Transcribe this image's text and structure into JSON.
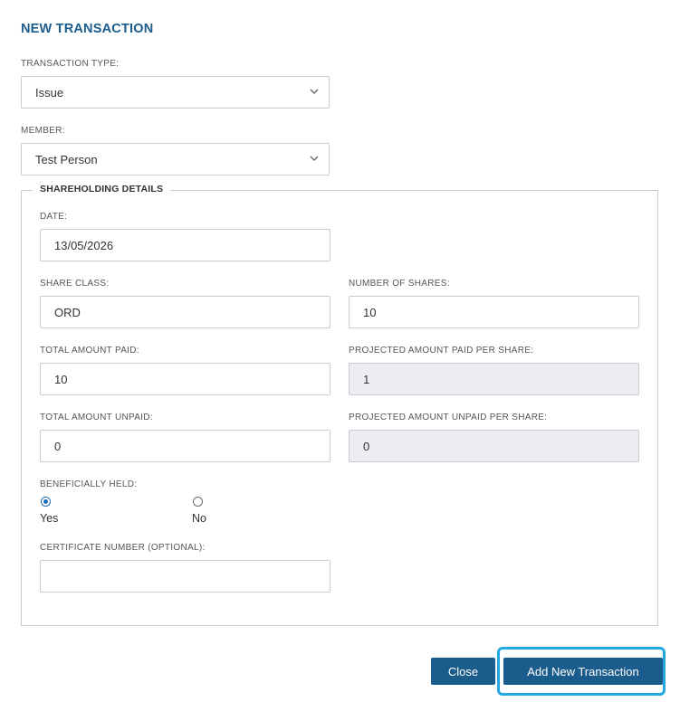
{
  "form": {
    "title": "NEW TRANSACTION",
    "transaction_type": {
      "label": "TRANSACTION TYPE:",
      "value": "Issue"
    },
    "member": {
      "label": "MEMBER:",
      "value": "Test Person"
    }
  },
  "shareholding": {
    "legend": "SHAREHOLDING DETAILS",
    "date": {
      "label": "DATE:",
      "value": "13/05/2026"
    },
    "share_class": {
      "label": "SHARE CLASS:",
      "value": "ORD"
    },
    "number_of_shares": {
      "label": "NUMBER OF SHARES:",
      "value": "10"
    },
    "total_amount_paid": {
      "label": "TOTAL AMOUNT PAID:",
      "value": "10"
    },
    "projected_paid_per_share": {
      "label": "PROJECTED AMOUNT PAID PER SHARE:",
      "value": "1"
    },
    "total_amount_unpaid": {
      "label": "TOTAL AMOUNT UNPAID:",
      "value": "0"
    },
    "projected_unpaid_per_share": {
      "label": "PROJECTED AMOUNT UNPAID PER SHARE:",
      "value": "0"
    },
    "beneficially_held": {
      "label": "BENEFICIALLY HELD:",
      "yes": "Yes",
      "no": "No",
      "selected": "Yes"
    },
    "certificate_number": {
      "label": "CERTIFICATE NUMBER (OPTIONAL):",
      "value": ""
    }
  },
  "actions": {
    "close": "Close",
    "add": "Add New Transaction"
  },
  "colors": {
    "accent": "#1a5c8c",
    "focus": "#22a7e0",
    "readonly_bg": "#eceef1"
  }
}
